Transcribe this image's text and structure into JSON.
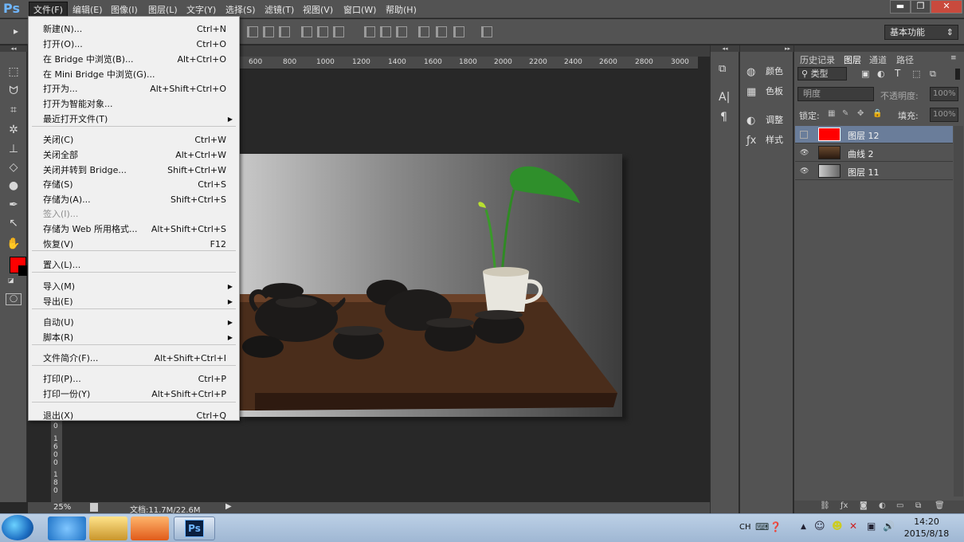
{
  "app": {
    "logo": "Ps"
  },
  "menubar": {
    "items": [
      "文件(F)",
      "编辑(E)",
      "图像(I)",
      "图层(L)",
      "文字(Y)",
      "选择(S)",
      "滤镜(T)",
      "视图(V)",
      "窗口(W)",
      "帮助(H)"
    ]
  },
  "window_controls": {
    "minimize": "▬",
    "restore": "❐",
    "close": "✕"
  },
  "workspace": {
    "label": "基本功能"
  },
  "ruler": {
    "ticks": [
      "600",
      "800",
      "1000",
      "1200",
      "1400",
      "1600",
      "1800",
      "2000",
      "2200",
      "2400",
      "2600",
      "2800",
      "3000"
    ],
    "v_labels": [
      "0",
      "1",
      "6",
      "0",
      "0",
      "1",
      "8",
      "0"
    ]
  },
  "file_menu": {
    "items": [
      {
        "label": "新建(N)...",
        "shortcut": "Ctrl+N"
      },
      {
        "label": "打开(O)...",
        "shortcut": "Ctrl+O"
      },
      {
        "label": "在 Bridge 中浏览(B)...",
        "shortcut": "Alt+Ctrl+O"
      },
      {
        "label": "在 Mini Bridge 中浏览(G)...",
        "shortcut": ""
      },
      {
        "label": "打开为...",
        "shortcut": "Alt+Shift+Ctrl+O"
      },
      {
        "label": "打开为智能对象...",
        "shortcut": ""
      },
      {
        "label": "最近打开文件(T)",
        "shortcut": "",
        "submenu": true
      },
      {
        "label": "关闭(C)",
        "shortcut": "Ctrl+W"
      },
      {
        "label": "关闭全部",
        "shortcut": "Alt+Ctrl+W"
      },
      {
        "label": "关闭并转到 Bridge...",
        "shortcut": "Shift+Ctrl+W"
      },
      {
        "label": "存储(S)",
        "shortcut": "Ctrl+S"
      },
      {
        "label": "存储为(A)...",
        "shortcut": "Shift+Ctrl+S"
      },
      {
        "label": "签入(I)...",
        "shortcut": "",
        "disabled": true
      },
      {
        "label": "存储为 Web 所用格式...",
        "shortcut": "Alt+Shift+Ctrl+S"
      },
      {
        "label": "恢复(V)",
        "shortcut": "F12"
      },
      {
        "label": "置入(L)...",
        "shortcut": ""
      },
      {
        "label": "导入(M)",
        "shortcut": "",
        "submenu": true
      },
      {
        "label": "导出(E)",
        "shortcut": "",
        "submenu": true
      },
      {
        "label": "自动(U)",
        "shortcut": "",
        "submenu": true
      },
      {
        "label": "脚本(R)",
        "shortcut": "",
        "submenu": true
      },
      {
        "label": "文件简介(F)...",
        "shortcut": "Alt+Shift+Ctrl+I"
      },
      {
        "label": "打印(P)...",
        "shortcut": "Ctrl+P"
      },
      {
        "label": "打印一份(Y)",
        "shortcut": "Alt+Shift+Ctrl+P"
      },
      {
        "label": "退出(X)",
        "shortcut": "Ctrl+Q"
      }
    ]
  },
  "status": {
    "zoom": "25%",
    "doc": "文档:11.7M/22.6M"
  },
  "mid_panel": {
    "items": [
      "颜色",
      "色板",
      "调整",
      "样式"
    ]
  },
  "layers_panel": {
    "tabs": [
      "历史记录",
      "图层",
      "通道",
      "路径"
    ],
    "filter_kind": "类型",
    "blend_mode": "明度",
    "opacity_label": "不透明度:",
    "opacity_value": "100%",
    "lock_label": "锁定:",
    "fill_label": "填充:",
    "fill_value": "100%",
    "layers": [
      {
        "name": "图层 12",
        "visible": false,
        "selected": true,
        "thumb": "#ff0000"
      },
      {
        "name": "曲线 2",
        "visible": true,
        "selected": false,
        "thumb": "#3a2a20"
      },
      {
        "name": "图层 11",
        "visible": true,
        "selected": false,
        "thumb": "#9a9a9a"
      }
    ]
  },
  "colors": {
    "foreground": "#ff0000",
    "background": "#000000"
  },
  "taskbar": {
    "time": "14:20",
    "date": "2015/8/18",
    "lang": "CH"
  }
}
